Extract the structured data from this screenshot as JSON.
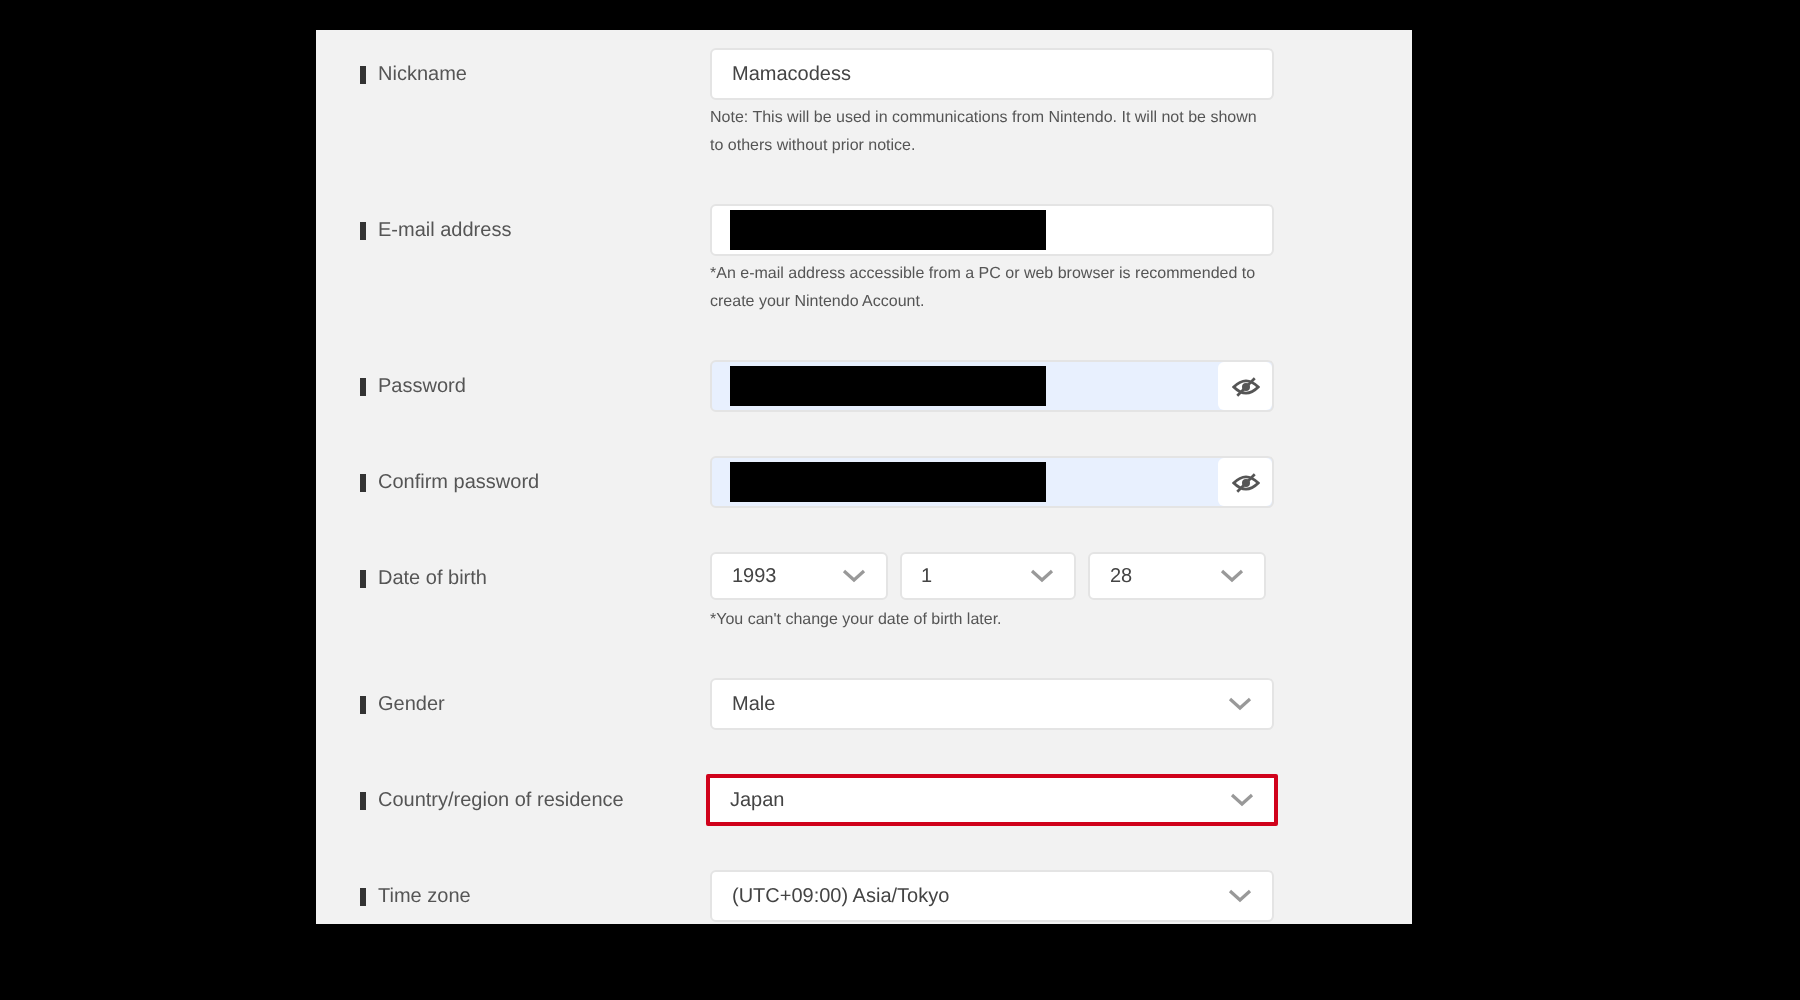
{
  "fields": [
    {
      "kind": "text",
      "label": "Nickname",
      "value": "Mamacodess",
      "note": "Note: This will be used in communications from Nintendo. It will not be shown to others without prior notice."
    },
    {
      "kind": "text",
      "label": "E-mail address",
      "redacted": true,
      "note": "*An e-mail address accessible from a PC or web browser is recommended to create your Nintendo Account."
    },
    {
      "kind": "password",
      "label": "Password",
      "redacted": true
    },
    {
      "kind": "password",
      "label": "Confirm password",
      "redacted": true
    },
    {
      "kind": "date",
      "label": "Date of birth",
      "parts": [
        "1993",
        "1",
        "28"
      ],
      "note": "*You can't change your date of birth later."
    },
    {
      "kind": "select",
      "label": "Gender",
      "value": "Male",
      "highlighted": false
    },
    {
      "kind": "select",
      "label": "Country/region of residence",
      "value": "Japan",
      "highlighted": true
    },
    {
      "kind": "select",
      "label": "Time zone",
      "value": "(UTC+09:00) Asia/Tokyo",
      "highlighted": false
    }
  ]
}
